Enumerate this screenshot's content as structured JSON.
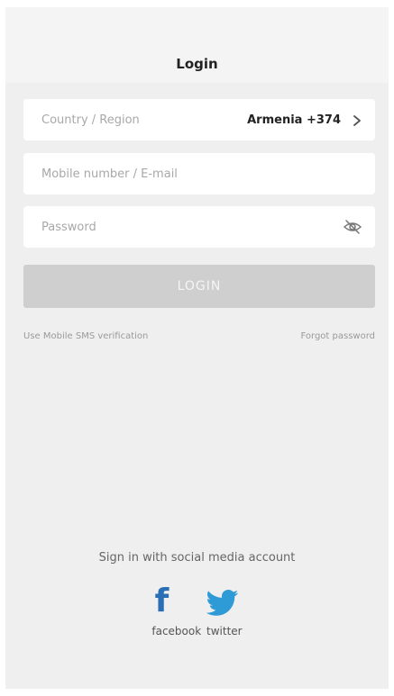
{
  "header": {
    "title": "Login"
  },
  "form": {
    "country_label": "Country / Region",
    "country_value": "Armenia +374",
    "account_placeholder": "Mobile number / E-mail",
    "password_placeholder": "Password",
    "login_label": "LOGIN",
    "sms_link": "Use Mobile SMS verification",
    "forgot_link": "Forgot password"
  },
  "social": {
    "title": "Sign in with social media account",
    "facebook_label": "facebook",
    "twitter_label": "twitter",
    "facebook_glyph": "f"
  },
  "icons": {
    "chevron": "chevron-right-icon",
    "eye": "eye-off-icon",
    "facebook": "facebook-icon",
    "twitter": "twitter-icon"
  },
  "colors": {
    "background": "#efefef",
    "login_disabled": "#cfcfcf",
    "facebook": "#2a6fb6",
    "twitter": "#2e9ad6"
  }
}
